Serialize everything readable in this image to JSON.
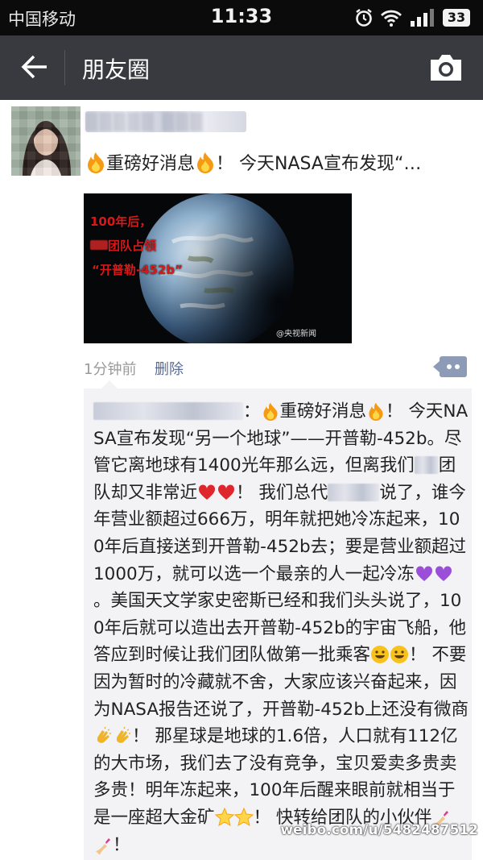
{
  "status_bar": {
    "carrier": "中国移动",
    "time": "11:33",
    "battery": "33"
  },
  "nav": {
    "title": "朋友圈"
  },
  "post": {
    "author_blurred": "▒▒▒▒▒ ▒▒▒ ▒▒▒",
    "text_parts": [
      "重磅好消息",
      "！ 今天NASA宣布发现“…"
    ],
    "image_caption_line1": "100年后，",
    "image_caption_line2": "团队占领",
    "image_caption_line3": "“开普勒-452b”",
    "image_watermark": "@央视新闻",
    "time_ago": "1分钟前",
    "delete_label": "删除"
  },
  "comment": {
    "seg1": "：",
    "seg2": "重磅好消息",
    "seg3": "！ 今天NASA宣布发现“另一个地球”——开普勒-452b。尽管它离地球有1400光年那么远，但离我们",
    "seg4": "团队却又非常近",
    "seg5": "！ 我们总代",
    "seg6": "说了，谁今年营业额超过666万，明年就把她冷冻起来，100年后直接送到开普勒-452b去；要是营业额超过1000万，就可以选一个最亲的人一起冷冻",
    "seg7": "。美国天文学家史密斯已经和我们头头说了，100年后就可以造出去开普勒-452b的宇宙飞船，他答应到时候让我们团队做第一批乘客",
    "seg8": "！ 不要因为暂时的冷藏就不舍，大家应该兴奋起来，因为NASA报告还说了，开普勒-452b上还没有微商",
    "seg9": "！ 那星球是地球的1.6倍，人口就有112亿的大市场，我们去了没有竞争，宝贝爱卖多贵卖多贵！明年冻起来，100年后醒来眼前就相当于是一座超大金矿",
    "seg10": "！ 快转给团队的小伙伴",
    "seg11": "！"
  },
  "footer": {
    "weibo": "weibo.com/u/5482487512"
  },
  "icons": {
    "back": "back-arrow-icon",
    "camera": "camera-icon",
    "comment": "more-comment-icon"
  }
}
